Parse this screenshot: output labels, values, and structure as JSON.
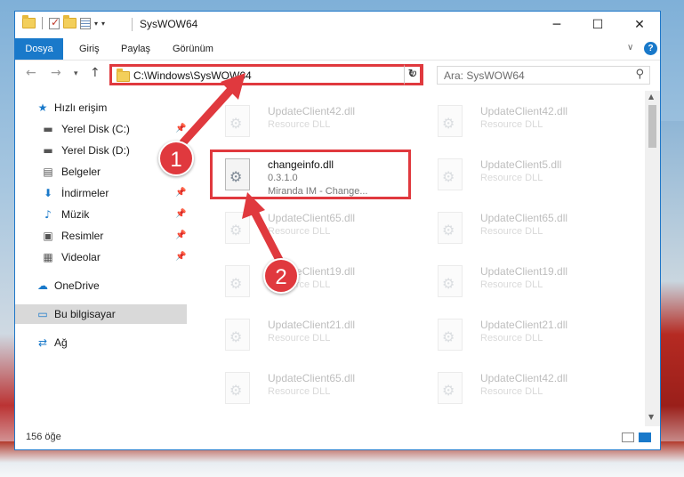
{
  "window": {
    "title": "SysWOW64",
    "minimize": "─",
    "maximize": "☐",
    "close": "✕"
  },
  "ribbon": {
    "tabs": [
      "Dosya",
      "Giriş",
      "Paylaş",
      "Görünüm"
    ],
    "help": "?"
  },
  "nav": {
    "address": "C:\\Windows\\SysWOW64",
    "search_placeholder": "Ara: SysWOW64"
  },
  "sidebar": {
    "items": [
      {
        "label": "Hızlı erişim",
        "icon": "star-icon"
      },
      {
        "label": "Yerel Disk (C:)",
        "icon": "drive-icon"
      },
      {
        "label": "Yerel Disk (D:)",
        "icon": "drive-icon"
      },
      {
        "label": "Belgeler",
        "icon": "documents-icon"
      },
      {
        "label": "İndirmeler",
        "icon": "download-icon"
      },
      {
        "label": "Müzik",
        "icon": "music-icon"
      },
      {
        "label": "Resimler",
        "icon": "pictures-icon"
      },
      {
        "label": "Videolar",
        "icon": "videos-icon"
      },
      {
        "label": "OneDrive",
        "icon": "cloud-icon"
      },
      {
        "label": "Bu bilgisayar",
        "icon": "computer-icon"
      },
      {
        "label": "Ağ",
        "icon": "network-icon"
      }
    ]
  },
  "files": {
    "left": [
      {
        "name": "UpdateClient42.dll",
        "desc": "Resource DLL"
      },
      {
        "name": "changeinfo.dll",
        "version": "0.3.1.0",
        "desc": "Miranda IM - Change..."
      },
      {
        "name": "UpdateClient65.dll",
        "desc": "Resource DLL"
      },
      {
        "name": "UpdateClient19.dll",
        "desc": "Resource DLL"
      },
      {
        "name": "UpdateClient21.dll",
        "desc": "Resource DLL"
      },
      {
        "name": "UpdateClient65.dll",
        "desc": "Resource DLL"
      }
    ],
    "right": [
      {
        "name": "UpdateClient42.dll",
        "desc": "Resource DLL"
      },
      {
        "name": "UpdateClient5.dll",
        "desc": "Resource DLL"
      },
      {
        "name": "UpdateClient65.dll",
        "desc": "Resource DLL"
      },
      {
        "name": "UpdateClient19.dll",
        "desc": "Resource DLL"
      },
      {
        "name": "UpdateClient21.dll",
        "desc": "Resource DLL"
      },
      {
        "name": "UpdateClient42.dll",
        "desc": "Resource DLL"
      }
    ]
  },
  "status": {
    "count": "156 öğe"
  },
  "annotations": {
    "step1": "1",
    "step2": "2",
    "color": "#e0393e"
  }
}
